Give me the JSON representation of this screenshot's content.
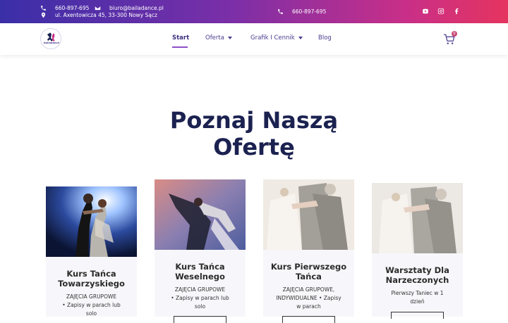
{
  "topbar": {
    "phone_left": "660-897-695",
    "email": "biuro@bailadance.pl",
    "address": "ul. Axentowicza 45, 33-300 Nowy Sącz",
    "phone_center": "660-897-695",
    "social": [
      "youtube-icon",
      "instagram-icon",
      "facebook-icon"
    ]
  },
  "header": {
    "logo_text": "bailadance",
    "nav": [
      {
        "label": "Start",
        "active": true
      },
      {
        "label": "Oferta",
        "dropdown": true
      },
      {
        "label": "Grafik I Cennik",
        "dropdown": true
      },
      {
        "label": "Blog"
      }
    ],
    "cart_count": "0"
  },
  "main": {
    "heading_line1": "Poznaj Naszą",
    "heading_line2": "Ofertę",
    "cards": [
      {
        "title_line1": "Kurs Tańca",
        "title_line2": "Towarzyskiego",
        "desc_line1": "ZAJĘCIA GRUPOWE",
        "desc_line2": "• Zapisy w parach lub",
        "desc_line3": "solo"
      },
      {
        "title_line1": "Kurs Tańca",
        "title_line2": "Weselnego",
        "desc_line1": "ZAJĘCIA GRUPOWE",
        "desc_line2": "• Zapisy w parach lub",
        "desc_line3": "solo"
      },
      {
        "title_line1": "Kurs Pierwszego",
        "title_line2": "Tańca",
        "desc_line1": "ZAJĘCIA GRUPOWE,",
        "desc_line2": "INDYWIDUALNE • Zapisy",
        "desc_line3": "w parach"
      },
      {
        "title_line1": "Warsztaty Dla",
        "title_line2": "Narzeczonych",
        "desc_line1": "Pierwszy Taniec w 1",
        "desc_line2": "dzień",
        "desc_line3": ""
      }
    ]
  },
  "colors": {
    "gradient_start": "#3a2fa8",
    "gradient_end": "#e5345f",
    "heading": "#1b2250",
    "nav_text": "#4a3d8f",
    "accent": "#8c4fc9"
  }
}
